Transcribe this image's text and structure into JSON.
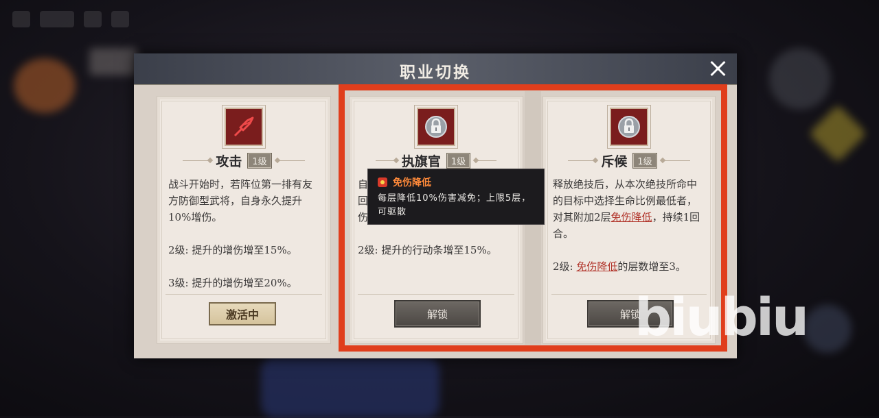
{
  "dialog": {
    "title": "职业切换",
    "close_icon": "close-icon"
  },
  "cards": [
    {
      "name": "攻击",
      "level": "1级",
      "icon": "sword-icon",
      "desc": [
        "战斗开始时，若阵位第一排有友方防御型武将，自身永久提升10%增伤。",
        "2级: 提升的增伤增至15%。",
        "3级: 提升的增伤增至20%。"
      ],
      "status": "激活中"
    },
    {
      "name": "执旗官",
      "level": "1级",
      "icon": "lock-icon",
      "desc_hidden_prefix": [
        "自",
        "回",
        "伤"
      ],
      "desc_level2": "2级: 提升的行动条增至15%。",
      "button": "解锁"
    },
    {
      "name": "斥候",
      "level": "1级",
      "icon": "lock-icon",
      "desc_part1": "释放绝技后，从本次绝技所命中的目标中选择生命比例最低者，对其附加2层",
      "desc_link1": "免伤降低",
      "desc_part2": "，持续1回合。",
      "desc_level2_prefix": "2级: ",
      "desc_link2": "免伤降低",
      "desc_level2_suffix": "的层数增至3。",
      "button": "解锁"
    }
  ],
  "tooltip": {
    "icon": "debuff-icon",
    "title": "免伤降低",
    "body": "每层降低10%伤害减免；上限5层，可驱散"
  },
  "watermark": "biubiu",
  "colors": {
    "highlight_frame": "#e03e1c",
    "emphasis_text": "#b1342a",
    "tooltip_title": "#ff8a3a"
  }
}
